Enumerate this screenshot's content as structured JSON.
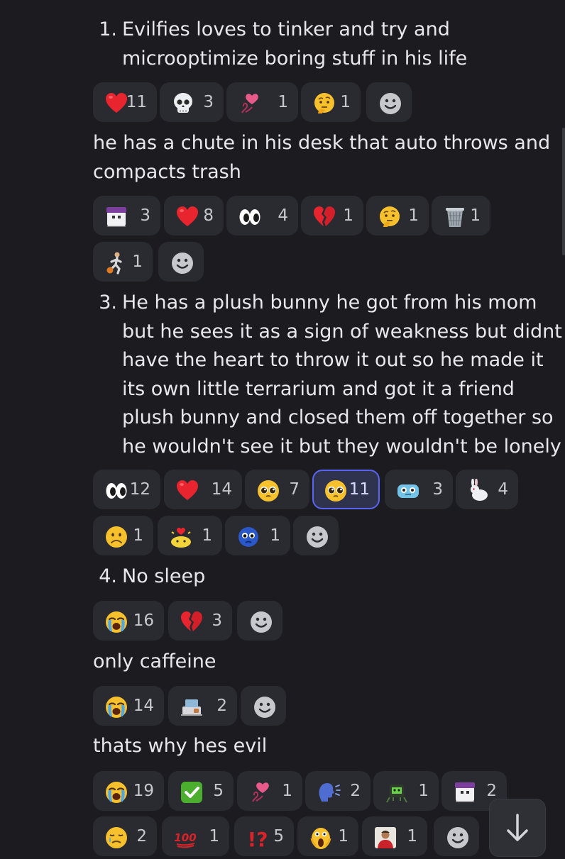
{
  "messages": [
    {
      "list_num": "1.",
      "text_lines": [
        "Evilfies loves to tinker and try and",
        "microoptimize boring stuff in his life"
      ]
    },
    {
      "text_lines": [
        "he has a chute in his desk that auto throws and",
        "compacts trash"
      ]
    },
    {
      "list_num": "3.",
      "text_lines": [
        "He has a plush bunny he got from his mom",
        "but he sees it as a sign of weakness but didnt",
        "have the heart to throw it out so he made it",
        "its own little terrarium and got it a friend",
        "plush bunny and closed them off together so",
        "he wouldn't see it but they wouldn't be lonely"
      ]
    },
    {
      "list_num": "4.",
      "text_lines": [
        "No sleep"
      ]
    },
    {
      "text_lines": [
        "only caffeine"
      ]
    },
    {
      "text_lines": [
        "thats why hes evil"
      ]
    }
  ],
  "reaction_rows": [
    [
      {
        "emoji": "red-heart-icon",
        "count": "11"
      },
      {
        "emoji": "skull-icon",
        "count": "3"
      },
      {
        "emoji": "heart-rose-sticker-icon",
        "count": "1"
      },
      {
        "emoji": "thinking-face-icon",
        "count": "1"
      }
    ],
    [
      {
        "emoji": "purple-hair-ghost-icon",
        "count": "3"
      },
      {
        "emoji": "red-heart-icon",
        "count": "8"
      },
      {
        "emoji": "eyes-icon",
        "count": "4"
      },
      {
        "emoji": "broken-heart-icon",
        "count": "1"
      },
      {
        "emoji": "thinking-face-icon",
        "count": "1"
      },
      {
        "emoji": "wastebasket-icon",
        "count": "1"
      }
    ],
    [
      {
        "emoji": "basketball-player-icon",
        "count": "1"
      }
    ],
    [
      {
        "emoji": "eyes-icon",
        "count": "12"
      },
      {
        "emoji": "red-heart-icon",
        "count": "14"
      },
      {
        "emoji": "pleading-face-icon",
        "count": "7"
      },
      {
        "emoji": "pleading-face-icon",
        "count": "11",
        "selected": true
      },
      {
        "emoji": "blue-creature-icon",
        "count": "3"
      },
      {
        "emoji": "rabbit-icon",
        "count": "4"
      }
    ],
    [
      {
        "emoji": "frowning-face-icon",
        "count": "1"
      },
      {
        "emoji": "yellow-heart-bubble-icon",
        "count": "1"
      },
      {
        "emoji": "blue-crying-face-icon",
        "count": "1"
      }
    ],
    [
      {
        "emoji": "loudly-crying-face-icon",
        "count": "16"
      },
      {
        "emoji": "broken-heart-icon",
        "count": "3"
      }
    ],
    [
      {
        "emoji": "loudly-crying-face-icon",
        "count": "14"
      },
      {
        "emoji": "coffee-laptop-sticker-icon",
        "count": "2"
      }
    ],
    [
      {
        "emoji": "loudly-crying-face-icon",
        "count": "19"
      },
      {
        "emoji": "check-mark-button-icon",
        "count": "5"
      },
      {
        "emoji": "heart-rose-sticker-icon",
        "count": "1"
      },
      {
        "emoji": "speaking-head-icon",
        "count": "2"
      },
      {
        "emoji": "green-robot-icon",
        "count": "1"
      },
      {
        "emoji": "purple-hair-ghost-icon",
        "count": "2"
      }
    ],
    [
      {
        "emoji": "sad-relieved-face-icon",
        "count": "2"
      },
      {
        "emoji": "hundred-points-icon",
        "count": "1"
      },
      {
        "emoji": "exclamation-question-mark-icon",
        "count": "5"
      },
      {
        "emoji": "screaming-face-icon",
        "count": "1"
      },
      {
        "emoji": "person-photo-icon",
        "count": "1"
      }
    ]
  ],
  "add_reaction_icon": "smiley-add-reaction-icon",
  "jump_button_icon": "arrow-down-icon",
  "colors": {
    "background": "#1c1c20",
    "pill": "#2a2b30",
    "pill_selected": "#30334d",
    "selected_border": "#5865f2",
    "text": "#e8e8ec",
    "count_text": "#c6c8cc"
  }
}
